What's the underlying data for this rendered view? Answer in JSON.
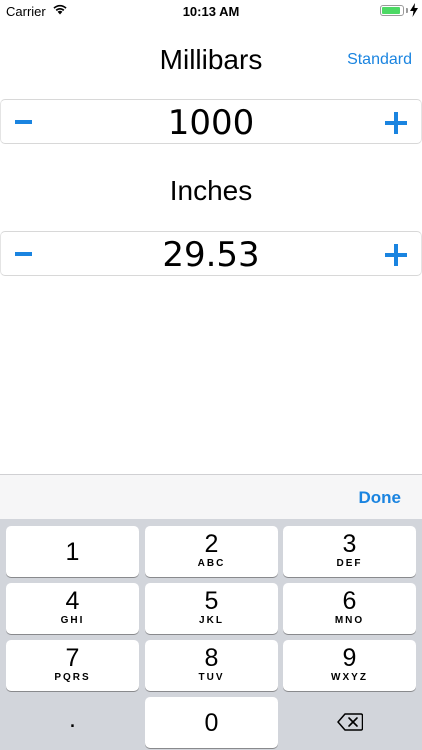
{
  "status_bar": {
    "carrier": "Carrier",
    "time": "10:13 AM",
    "battery_level": 0.9
  },
  "header": {
    "title": "Millibars",
    "standard_label": "Standard"
  },
  "millibars": {
    "value": "1000"
  },
  "inches": {
    "title": "Inches",
    "value": "29.53"
  },
  "accessory": {
    "done_label": "Done"
  },
  "keyboard": {
    "keys": [
      {
        "num": "1",
        "letters": ""
      },
      {
        "num": "2",
        "letters": "ABC"
      },
      {
        "num": "3",
        "letters": "DEF"
      },
      {
        "num": "4",
        "letters": "GHI"
      },
      {
        "num": "5",
        "letters": "JKL"
      },
      {
        "num": "6",
        "letters": "MNO"
      },
      {
        "num": "7",
        "letters": "PQRS"
      },
      {
        "num": "8",
        "letters": "TUV"
      },
      {
        "num": "9",
        "letters": "WXYZ"
      },
      {
        "num": ".",
        "letters": ""
      },
      {
        "num": "0",
        "letters": ""
      }
    ]
  },
  "colors": {
    "accent": "#1a84e0",
    "battery": "#4cd964",
    "keyboard_bg": "#d2d5db"
  },
  "icons": [
    "wifi-icon",
    "battery-icon",
    "charging-bolt-icon",
    "minus-icon",
    "plus-icon",
    "backspace-icon"
  ]
}
